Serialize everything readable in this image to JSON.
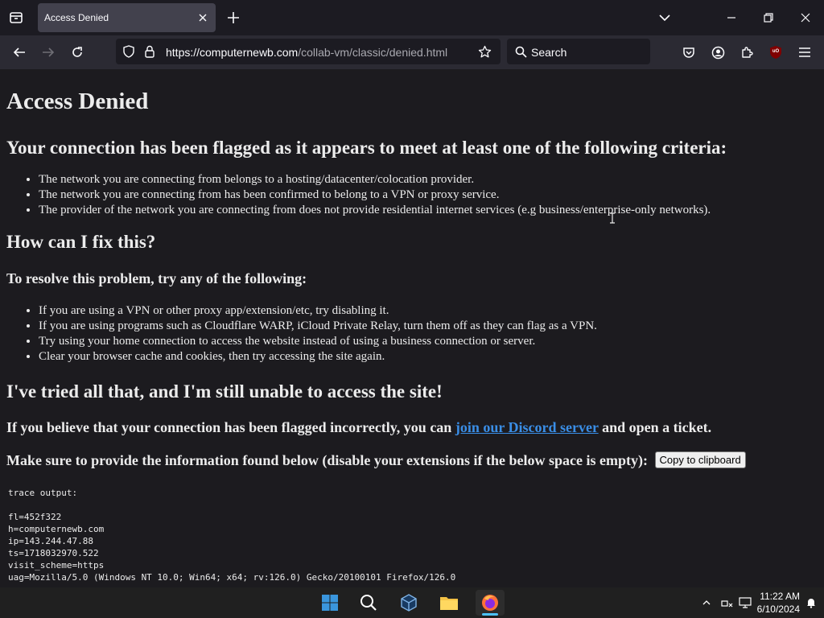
{
  "browser": {
    "tab_title": "Access Denied",
    "url_host": "https://computernewb.com",
    "url_path": "/collab-vm/classic/denied.html",
    "search_placeholder": "Search",
    "extension_badge": "uO"
  },
  "page": {
    "title": "Access Denied",
    "flagged_heading": "Your connection has been flagged as it appears to meet at least one of the following criteria:",
    "criteria": [
      "The network you are connecting from belongs to a hosting/datacenter/colocation provider.",
      "The network you are connecting from has been confirmed to belong to a VPN or proxy service.",
      "The provider of the network you are connecting from does not provide residential internet services (e.g business/enterprise-only networks)."
    ],
    "fix_heading": "How can I fix this?",
    "resolve_heading": "To resolve this problem, try any of the following:",
    "fixes": [
      "If you are using a VPN or other proxy app/extension/etc, try disabling it.",
      "If you are using programs such as Cloudflare WARP, iCloud Private Relay, turn them off as they can flag as a VPN.",
      "Try using your home connection to access the website instead of using a business connection or server.",
      "Clear your browser cache and cookies, then try accessing the site again."
    ],
    "tried_heading": "I've tried all that, and I'm still unable to access the site!",
    "incorrect_before": "If you believe that your connection has been flagged incorrectly, you can ",
    "discord_link": "join our Discord server",
    "incorrect_after": " and open a ticket.",
    "provide_info": "Make sure to provide the information found below (disable your extensions if the below space is empty):",
    "copy_button": "Copy to clipboard",
    "trace_label": "trace output:",
    "trace_lines": [
      "fl=452f322",
      "h=computernewb.com",
      "ip=143.244.47.88",
      "ts=1718032970.522",
      "visit_scheme=https",
      "uag=Mozilla/5.0 (Windows NT 10.0; Win64; x64; rv:126.0) Gecko/20100101 Firefox/126.0"
    ]
  },
  "taskbar": {
    "time": "11:22 AM",
    "date": "6/10/2024"
  },
  "colors": {
    "link": "#3a8ee6",
    "firefox_orange": "#ff7139",
    "windows_blue": "#3a96dd"
  }
}
